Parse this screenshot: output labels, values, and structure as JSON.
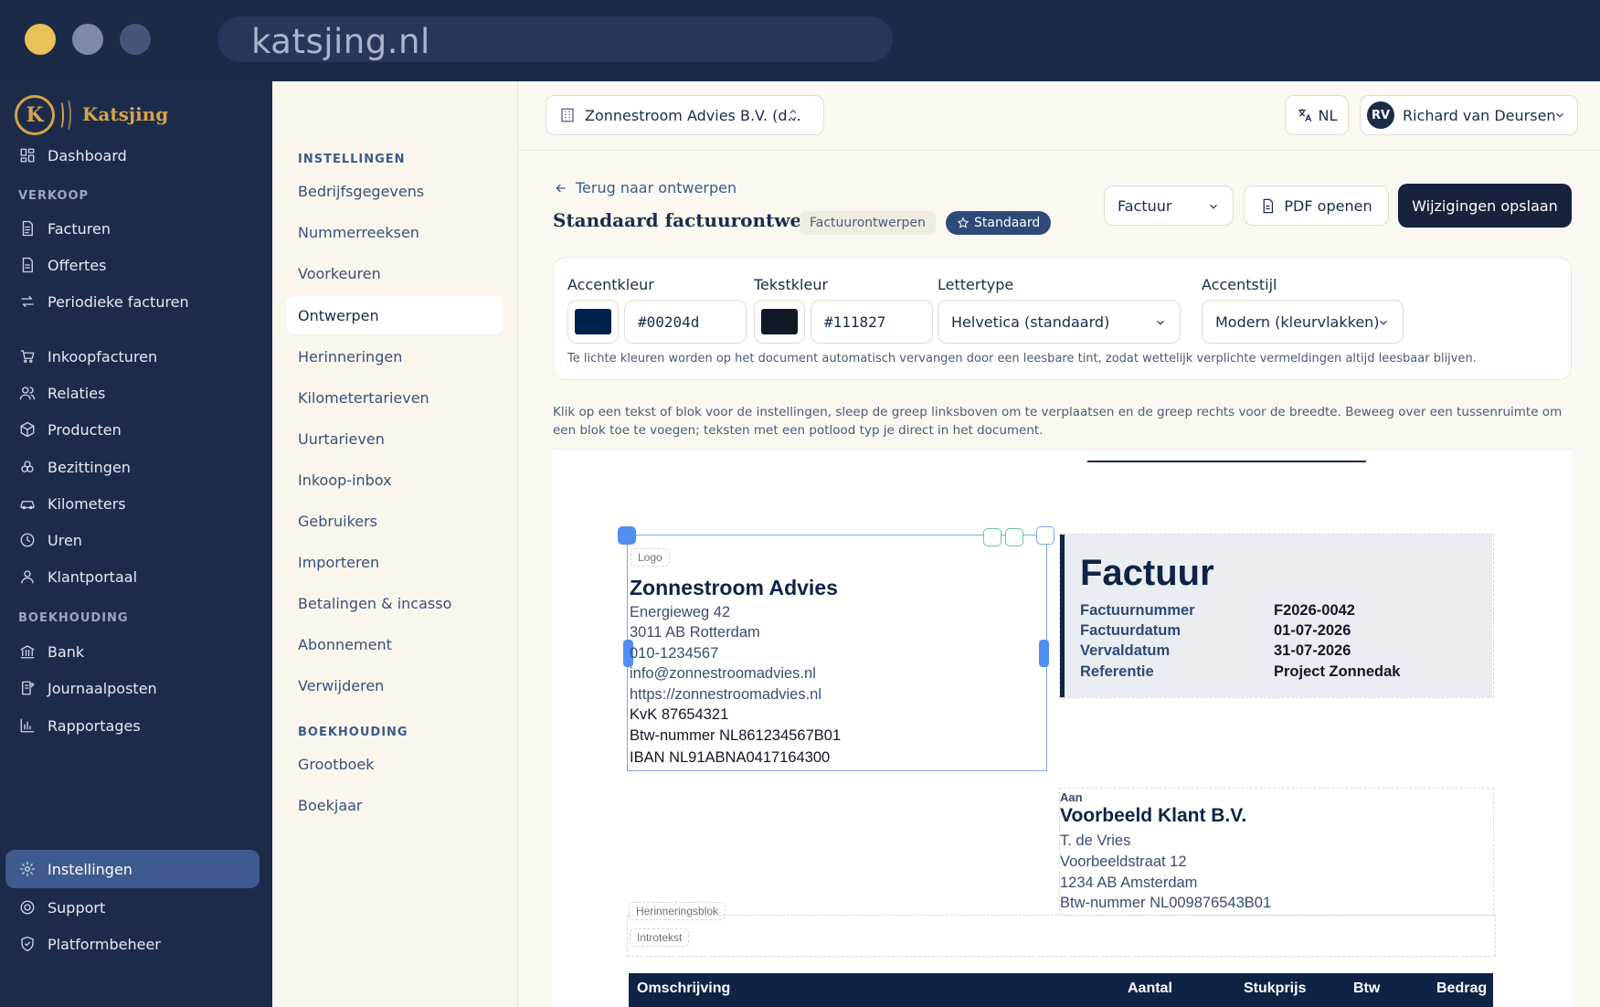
{
  "browser": {
    "url": "katsjing.nl"
  },
  "brand": {
    "name": "Katsjing",
    "logo_letter": "K",
    "accent_color": "#d4a34a"
  },
  "sidebar": {
    "items_top": [
      {
        "label": "Dashboard",
        "icon": "dashboard-icon"
      }
    ],
    "sections": [
      {
        "title": "VERKOOP"
      },
      {
        "title": "BOEKHOUDING"
      }
    ],
    "verkoop": [
      {
        "label": "Facturen",
        "icon": "invoice-icon"
      },
      {
        "label": "Offertes",
        "icon": "quote-icon"
      },
      {
        "label": "Periodieke facturen",
        "icon": "recurring-icon"
      }
    ],
    "other": [
      {
        "label": "Inkoopfacturen",
        "icon": "cart-icon"
      },
      {
        "label": "Relaties",
        "icon": "users-icon"
      },
      {
        "label": "Producten",
        "icon": "box-icon"
      },
      {
        "label": "Bezittingen",
        "icon": "assets-icon"
      },
      {
        "label": "Kilometers",
        "icon": "car-icon"
      },
      {
        "label": "Uren",
        "icon": "clock-icon"
      },
      {
        "label": "Klantportaal",
        "icon": "user-icon"
      }
    ],
    "boekhouding": [
      {
        "label": "Bank",
        "icon": "bank-icon"
      },
      {
        "label": "Journaalposten",
        "icon": "journal-icon"
      },
      {
        "label": "Rapportages",
        "icon": "chart-icon"
      }
    ],
    "bottom": [
      {
        "label": "Instellingen",
        "icon": "gear-icon",
        "active": true
      },
      {
        "label": "Support",
        "icon": "support-icon"
      },
      {
        "label": "Platformbeheer",
        "icon": "shield-icon"
      }
    ]
  },
  "subnav": {
    "section1": "INSTELLINGEN",
    "items1": [
      "Bedrijfsgegevens",
      "Nummerreeksen",
      "Voorkeuren",
      "Ontwerpen",
      "Herinneringen",
      "Kilometertarieven",
      "Uurtarieven",
      "Inkoop-inbox",
      "Gebruikers",
      "Importeren",
      "Betalingen & incasso",
      "Abonnement",
      "Verwijderen"
    ],
    "active": "Ontwerpen",
    "section2": "BOEKHOUDING",
    "items2": [
      "Grootboek",
      "Boekjaar"
    ]
  },
  "header": {
    "company": "Zonnestroom Advies B.V. (d...",
    "language": "NL",
    "user_initials": "RV",
    "user_name": "Richard van Deursen"
  },
  "page": {
    "back_link": "Terug naar ontwerpen",
    "title": "Standaard factuurontwerp",
    "badge_type": "Factuurontwerpen",
    "badge_default": "Standaard",
    "doc_type": "Factuur",
    "pdf_button": "PDF openen",
    "save_button": "Wijzigingen opslaan"
  },
  "style_panel": {
    "accent_label": "Accentkleur",
    "accent_value": "#00204d",
    "text_color_label": "Tekstkleur",
    "text_color_value": "#111827",
    "font_label": "Lettertype",
    "font_value": "Helvetica (standaard)",
    "accent_style_label": "Accentstijl",
    "accent_style_value": "Modern (kleurvlakken)",
    "hint": "Te lichte kleuren worden op het document automatisch vervangen door een leesbare tint, zodat wettelijk verplichte vermeldingen altijd leesbaar blijven."
  },
  "canvas_hint": "Klik op een tekst of blok voor de instellingen, sleep de greep linksboven om te verplaatsen en de greep rechts voor de breedte. Beweeg over een tussenruimte om een blok toe te voegen; teksten met een potlood typ je direct in het document.",
  "document": {
    "logo_tag": "Logo",
    "sender": {
      "name": "Zonnestroom Advies",
      "lines": [
        "Energieweg 42",
        "3011 AB Rotterdam",
        "010-1234567",
        "info@zonnestroomadvies.nl",
        "https://zonnestroomadvies.nl"
      ],
      "legal_lines": [
        "KvK 87654321",
        "Btw-nummer NL861234567B01",
        "IBAN NL91ABNA0417164300"
      ]
    },
    "title": "Factuur",
    "meta": [
      {
        "label": "Factuurnummer",
        "value": "F2026-0042"
      },
      {
        "label": "Factuurdatum",
        "value": "01-07-2026"
      },
      {
        "label": "Vervaldatum",
        "value": "31-07-2026"
      },
      {
        "label": "Referentie",
        "value": "Project Zonnedak"
      }
    ],
    "recipient": {
      "to_label": "Aan",
      "name": "Voorbeeld Klant B.V.",
      "lines": [
        "T. de Vries",
        "Voorbeeldstraat 12",
        "1234 AB Amsterdam",
        "Btw-nummer NL009876543B01"
      ]
    },
    "reminder_tag": "Herinneringsblok",
    "intro_tag": "Introtekst",
    "table_headers": [
      "Omschrijving",
      "Aantal",
      "Stukprijs",
      "Btw",
      "Bedrag"
    ]
  }
}
